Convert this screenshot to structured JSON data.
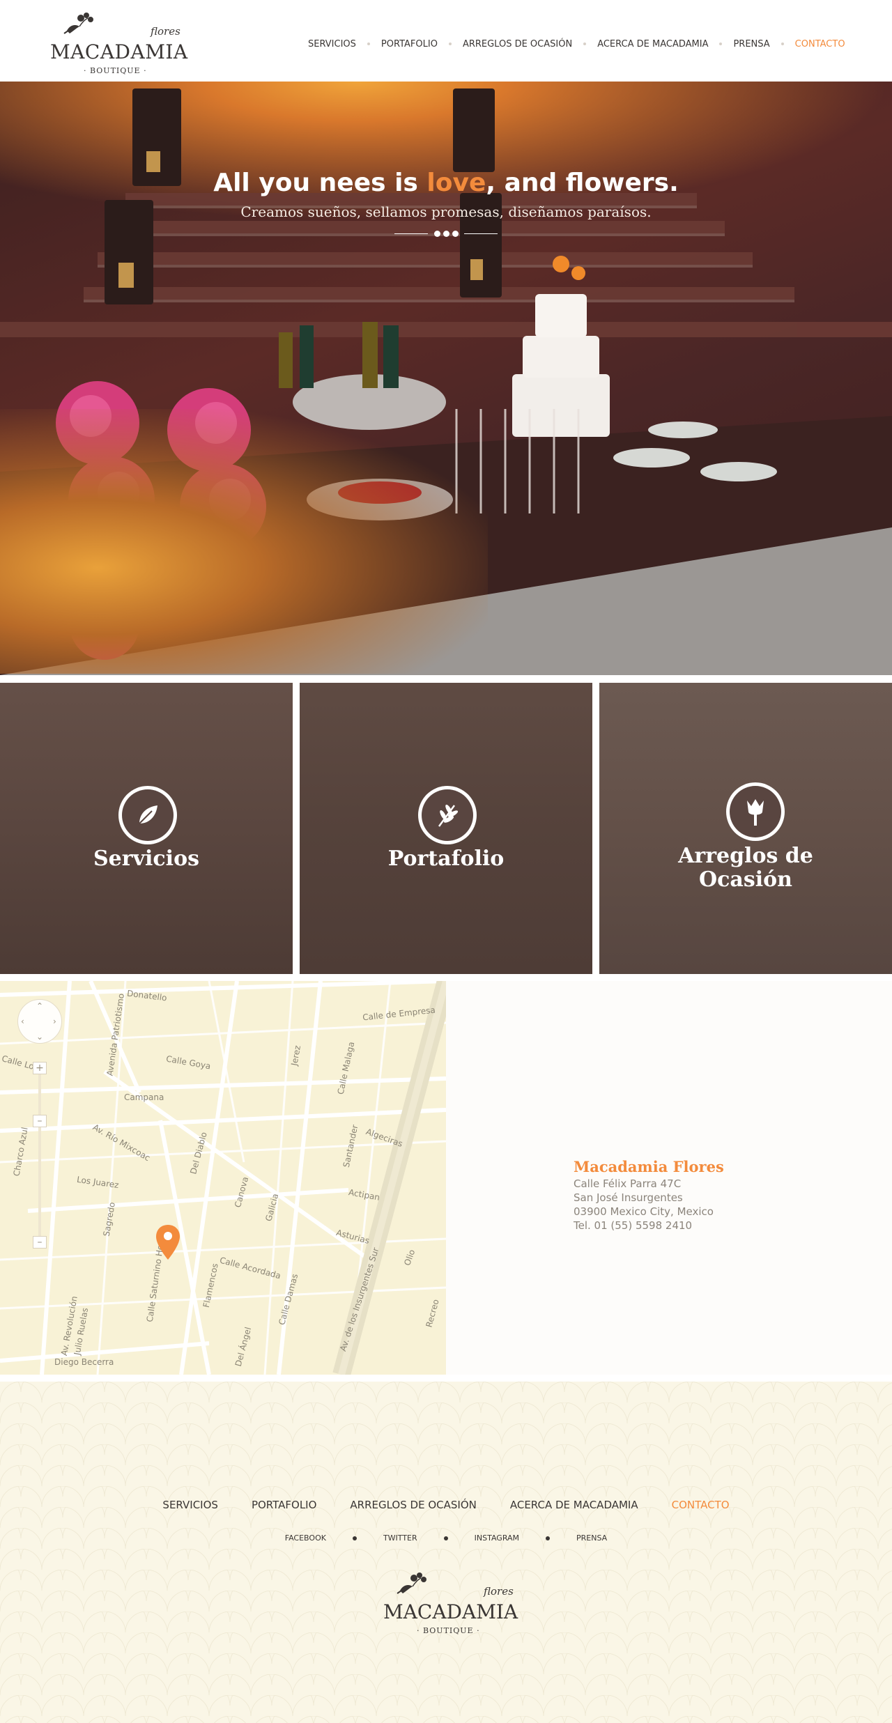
{
  "brand": {
    "script": "flores",
    "name": "MACADAMIA",
    "sub": "· BOUTIQUE ·"
  },
  "nav": {
    "items": [
      {
        "label": "SERVICIOS"
      },
      {
        "label": "PORTAFOLIO"
      },
      {
        "label": "ARREGLOS DE OCASIÓN"
      },
      {
        "label": "ACERCA DE MACADAMIA"
      },
      {
        "label": "PRENSA"
      },
      {
        "label": "CONTACTO"
      }
    ],
    "active": "CONTACTO"
  },
  "hero": {
    "headline_pre": "All you nees is ",
    "headline_love": "love",
    "headline_post": ", and flowers.",
    "tagline": "Creamos sueños, sellamos promesas, diseñamos paraísos."
  },
  "tiles": [
    {
      "title": "Servicios",
      "icon": "leaf-icon"
    },
    {
      "title": "Portafolio",
      "icon": "branch-icon"
    },
    {
      "title": "Arreglos de Ocasión",
      "icon": "tulip-icon"
    }
  ],
  "map": {
    "streets": [
      "Donatello",
      "Calle de Empresa",
      "Calle Goya",
      "Campana",
      "Av. Río Mixcoac",
      "Del Diablo",
      "Canova",
      "Galicia",
      "Actipan",
      "Asturias",
      "Los Juarez",
      "Sagredo",
      "Av. Revolución",
      "Calle Saturnino Herrán",
      "Flamencos",
      "Calle Acordada",
      "Calle Damas",
      "Del Ángel",
      "Julio Ruelas",
      "Diego Becerra",
      "Av. de los Insurgentes Sur",
      "Jerez",
      "Calle Malaga",
      "Santander",
      "Algeciras",
      "Avenida Patriotismo",
      "Charco Azul",
      "Olio",
      "Recreo",
      "Calle Lo"
    ]
  },
  "address": {
    "name": "Macadamia Flores",
    "line1": "Calle Félix Parra 47C",
    "line2": "San José Insurgentes",
    "line3": "03900 Mexico City, Mexico",
    "phone": "Tel. 01 (55) 5598 2410"
  },
  "footer": {
    "nav": [
      {
        "label": "SERVICIOS"
      },
      {
        "label": "PORTAFOLIO"
      },
      {
        "label": "ARREGLOS DE OCASIÓN"
      },
      {
        "label": "ACERCA DE MACADAMIA"
      },
      {
        "label": "CONTACTO"
      }
    ],
    "social": [
      {
        "label": "FACEBOOK"
      },
      {
        "label": "TWITTER"
      },
      {
        "label": "INSTAGRAM"
      },
      {
        "label": "PRENSA"
      }
    ]
  },
  "colors": {
    "accent": "#f38b3c",
    "text": "#3a3634",
    "footer_bg": "#faf6e6",
    "tile_bg": "#5e4a42"
  }
}
